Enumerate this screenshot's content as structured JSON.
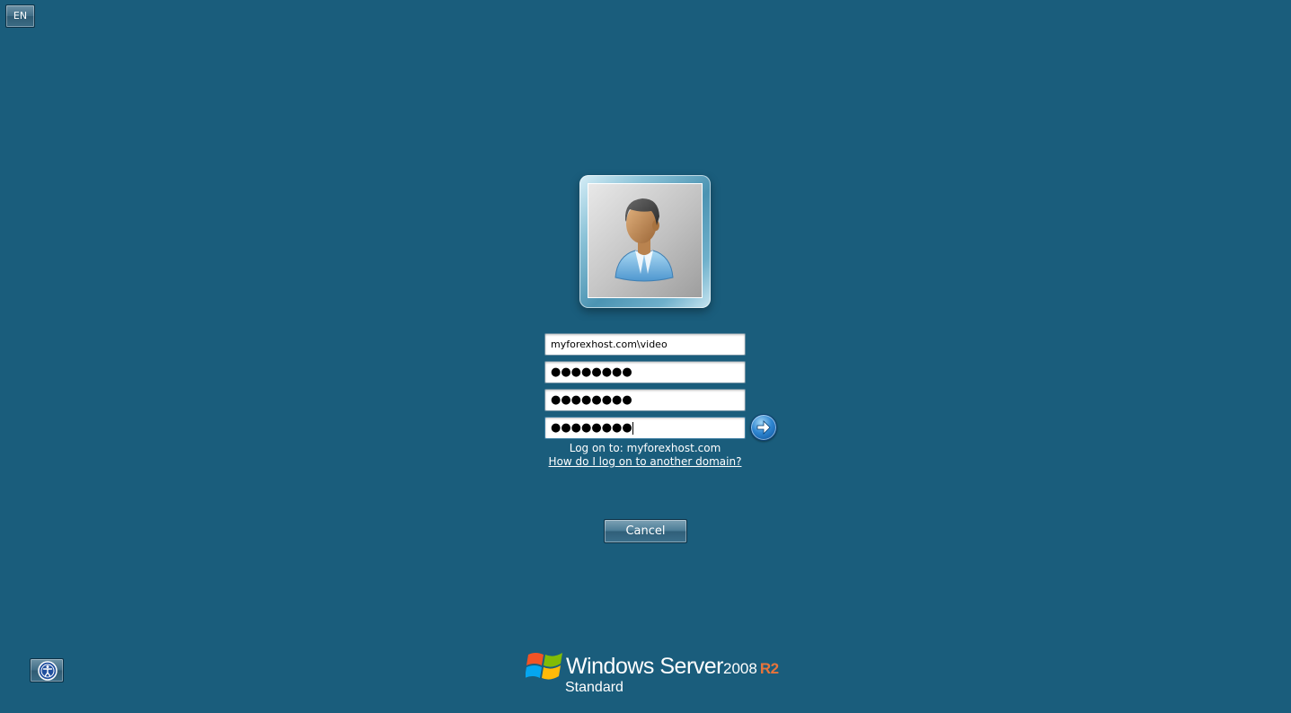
{
  "language_button": {
    "label": "EN"
  },
  "logon": {
    "username": "myforexhost.com\\video",
    "old_password_mask": "●●●●●●●●",
    "new_password_mask": "●●●●●●●●",
    "confirm_password_mask": "●●●●●●●●",
    "logon_to_text": "Log on to: myforexhost.com",
    "other_domain_link": "How do I log on to another domain?",
    "submit_icon": "arrow-right-icon"
  },
  "cancel_button": {
    "label": "Cancel"
  },
  "ease_of_access": {
    "icon": "ease-of-access-icon"
  },
  "branding": {
    "product": "Windows Server",
    "version": "2008",
    "release": "R2",
    "edition": "Standard",
    "accent_color": "#e8743b"
  },
  "colors": {
    "background": "#1a5d7c"
  }
}
